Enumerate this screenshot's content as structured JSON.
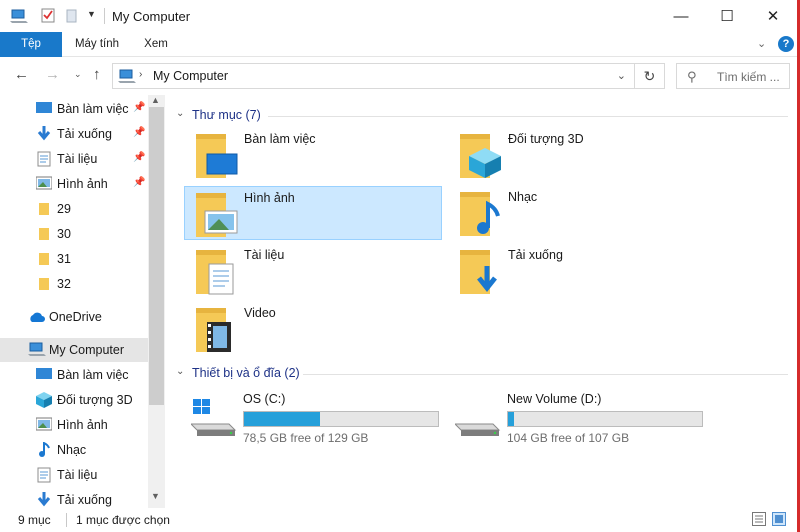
{
  "window": {
    "title": "My Computer",
    "controls": {
      "minimize": "—",
      "maximize": "☐",
      "close": "✕"
    }
  },
  "ribbon": {
    "tabs": [
      {
        "label": "Tệp",
        "active": true
      },
      {
        "label": "Máy tính"
      },
      {
        "label": "Xem"
      }
    ],
    "help": "?"
  },
  "navigation": {
    "address": "My Computer",
    "search_placeholder": "Tìm kiếm ..."
  },
  "nav_pane": {
    "quick_access": [
      {
        "label": "Bàn làm việc",
        "icon": "desktop-icon",
        "pinned": true
      },
      {
        "label": "Tải xuống",
        "icon": "download-icon",
        "pinned": true
      },
      {
        "label": "Tài liệu",
        "icon": "document-icon",
        "pinned": true
      },
      {
        "label": "Hình ảnh",
        "icon": "pictures-icon",
        "pinned": true
      },
      {
        "label": "29",
        "icon": "folder-icon"
      },
      {
        "label": "30",
        "icon": "folder-icon"
      },
      {
        "label": "31",
        "icon": "folder-icon"
      },
      {
        "label": "32",
        "icon": "folder-icon"
      }
    ],
    "onedrive": "OneDrive",
    "this_pc": "My Computer",
    "pc_children": [
      {
        "label": "Bàn làm việc",
        "icon": "desktop-icon"
      },
      {
        "label": "Đối tượng 3D",
        "icon": "3d-objects-icon"
      },
      {
        "label": "Hình ảnh",
        "icon": "pictures-icon"
      },
      {
        "label": "Nhạc",
        "icon": "music-icon"
      },
      {
        "label": "Tài liệu",
        "icon": "document-icon"
      },
      {
        "label": "Tải xuống",
        "icon": "download-icon"
      }
    ]
  },
  "content": {
    "folders_group": "Thư mục (7)",
    "folders": [
      {
        "name": "Bàn làm việc",
        "icon": "desktop-folder-icon"
      },
      {
        "name": "Đối tượng 3D",
        "icon": "3d-objects-folder-icon"
      },
      {
        "name": "Hình ảnh",
        "icon": "pictures-folder-icon",
        "selected": true
      },
      {
        "name": "Nhạc",
        "icon": "music-folder-icon"
      },
      {
        "name": "Tài liệu",
        "icon": "documents-folder-icon"
      },
      {
        "name": "Tải xuống",
        "icon": "downloads-folder-icon"
      },
      {
        "name": "Video",
        "icon": "videos-folder-icon"
      }
    ],
    "drives_group": "Thiết bị và ổ đĩa (2)",
    "drives": [
      {
        "name": "OS (C:)",
        "free": "78,5 GB free of 129 GB",
        "used_fraction": 0.39,
        "icon": "windows-drive-icon"
      },
      {
        "name": "New Volume (D:)",
        "free": "104 GB free of 107 GB",
        "used_fraction": 0.03,
        "icon": "hard-drive-icon"
      }
    ]
  },
  "status_bar": {
    "item_count": "9 mục",
    "selection": "1 mục được chọn"
  },
  "colors": {
    "accent": "#1979ca",
    "selection": "#cce8ff",
    "drive_fill": "#26a0da",
    "folder": "#f5c956"
  }
}
